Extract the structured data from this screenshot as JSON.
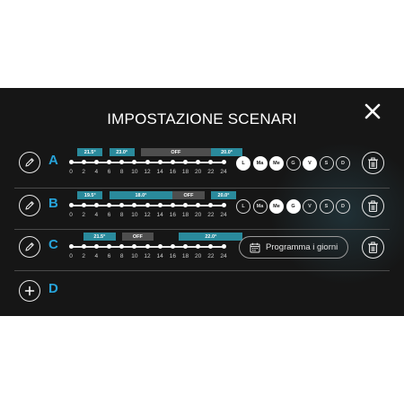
{
  "title": "IMPOSTAZIONE SCENARI",
  "ticks": [
    "0",
    "2",
    "4",
    "6",
    "8",
    "10",
    "12",
    "14",
    "16",
    "18",
    "20",
    "22",
    "24"
  ],
  "scenarios": [
    {
      "letter": "A",
      "segments": [
        {
          "from": 0.5,
          "to": 2.5,
          "label": "21.5°",
          "kind": "temp"
        },
        {
          "from": 3.0,
          "to": 5.0,
          "label": "23.0°",
          "kind": "temp"
        },
        {
          "from": 5.5,
          "to": 11.0,
          "label": "OFF",
          "kind": "off"
        },
        {
          "from": 11.0,
          "to": 13.5,
          "label": "20.0°",
          "kind": "temp"
        }
      ],
      "days": [
        {
          "label": "L",
          "active": true
        },
        {
          "label": "Ma",
          "active": true
        },
        {
          "label": "Me",
          "active": true
        },
        {
          "label": "G",
          "active": false
        },
        {
          "label": "V",
          "active": true
        },
        {
          "label": "S",
          "active": false
        },
        {
          "label": "D",
          "active": false
        }
      ]
    },
    {
      "letter": "B",
      "segments": [
        {
          "from": 0.5,
          "to": 2.5,
          "label": "19.5°",
          "kind": "temp"
        },
        {
          "from": 3.0,
          "to": 8.0,
          "label": "18.0°",
          "kind": "temp"
        },
        {
          "from": 8.0,
          "to": 10.5,
          "label": "OFF",
          "kind": "off"
        },
        {
          "from": 11.0,
          "to": 13.0,
          "label": "20.0°",
          "kind": "temp"
        }
      ],
      "days": [
        {
          "label": "L",
          "active": false
        },
        {
          "label": "Ma",
          "active": false
        },
        {
          "label": "Me",
          "active": true
        },
        {
          "label": "G",
          "active": true
        },
        {
          "label": "V",
          "active": false
        },
        {
          "label": "S",
          "active": false
        },
        {
          "label": "D",
          "active": false
        }
      ]
    },
    {
      "letter": "C",
      "segments": [
        {
          "from": 1.0,
          "to": 3.5,
          "label": "21.5°",
          "kind": "temp"
        },
        {
          "from": 4.0,
          "to": 6.5,
          "label": "OFF",
          "kind": "off"
        },
        {
          "from": 8.5,
          "to": 13.5,
          "label": "22.0°",
          "kind": "temp"
        }
      ],
      "schedule_label": "Programma i giorni"
    }
  ],
  "add_scenario_letter": "D",
  "colors": {
    "accent": "#27a3d9",
    "temp_segment": "#2a8a9c",
    "off_segment": "#4e4e4e",
    "panel": "#161616"
  },
  "icons": {
    "edit": "pencil-icon",
    "delete": "trash-icon",
    "close": "close-icon",
    "add": "plus-icon",
    "calendar": "calendar-icon"
  }
}
